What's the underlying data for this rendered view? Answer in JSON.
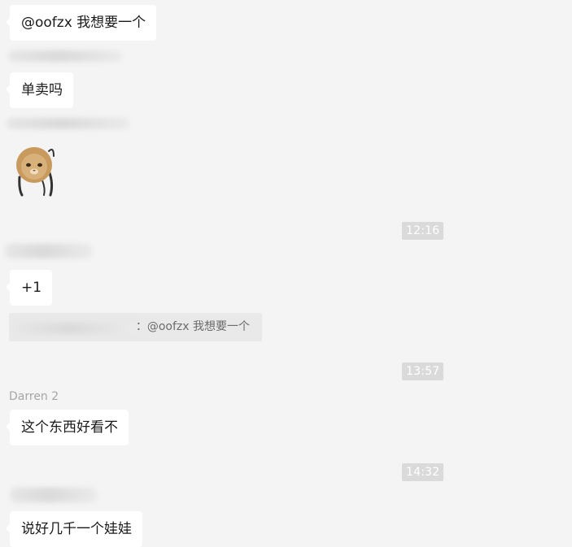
{
  "messages": [
    {
      "id": "m1",
      "text": "@oofzx 我想要一个"
    },
    {
      "id": "m2",
      "text": "单卖吗"
    },
    {
      "id": "m3",
      "sticker": "cat-face-sticker"
    },
    {
      "id": "m4",
      "text": "+1",
      "quote": "：@oofzx 我想要一个"
    },
    {
      "id": "m5",
      "sender": "Darren 2",
      "text": "这个东西好看不"
    },
    {
      "id": "m6",
      "text": "说好几千一个娃娃"
    }
  ],
  "timestamps": [
    "12:16",
    "13:57",
    "14:32"
  ],
  "colors": {
    "background": "#f4f4f4",
    "bubble": "#ffffff",
    "timestamp_bg": "#dadada",
    "quote_bg": "#e9e9e9",
    "sender_text": "#a6a6a6"
  }
}
